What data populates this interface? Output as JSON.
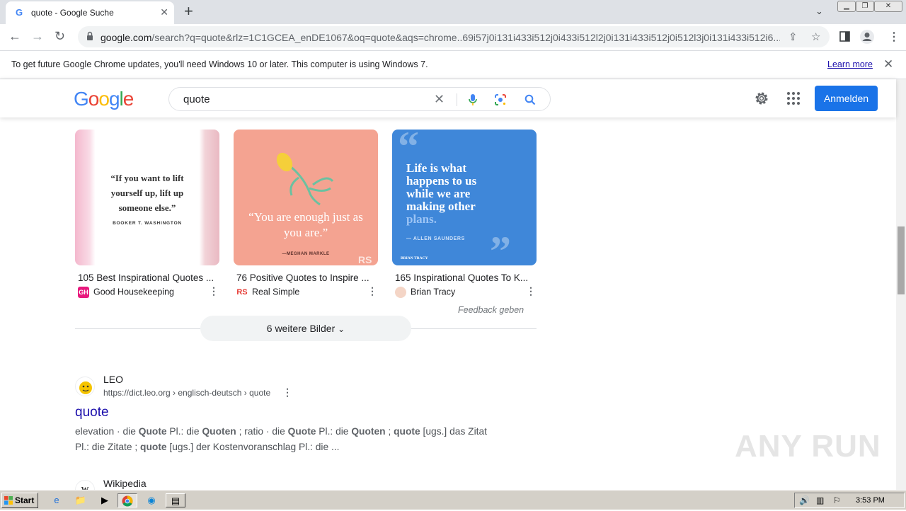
{
  "browser": {
    "tab_title": "quote - Google Suche",
    "url_host": "google.com",
    "url_rest": "/search?q=quote&rlz=1C1GCEA_enDE1067&oq=quote&aqs=chrome..69i57j0i131i433i512j0i433i512l2j0i131i433i512j0i512l3j0i131i433i512i6...",
    "infobar_message": "To get future Google Chrome updates, you'll need Windows 10 or later. This computer is using Windows 7.",
    "infobar_link": "Learn more"
  },
  "google": {
    "logo": "Google",
    "query": "quote",
    "signin_label": "Anmelden"
  },
  "images": [
    {
      "title": "105 Best Inspirational Quotes ...",
      "source": "Good Housekeeping",
      "source_icon": "GH",
      "quote": "“If you want to lift yourself up, lift up someone else.”",
      "author": "BOOKER T. WASHINGTON"
    },
    {
      "title": "76 Positive Quotes to Inspire ...",
      "source": "Real Simple",
      "source_icon": "RS",
      "quote": "“You are enough just as you are.”",
      "author": "—MEGHAN MARKLE"
    },
    {
      "title": "165 Inspirational Quotes To K...",
      "source": "Brian Tracy",
      "quote_main": "Life is what happens to us while we are making other",
      "quote_end": "plans.",
      "author": "— ALLEN SAUNDERS",
      "brand": "BRIAN TRACY"
    }
  ],
  "feedback": "Feedback geben",
  "more_images": "6 weitere Bilder",
  "results": [
    {
      "site": "LEO",
      "url": "https://dict.leo.org › englisch-deutsch › quote",
      "title": "quote"
    },
    {
      "site": "Wikipedia"
    }
  ],
  "snippet": {
    "s1": "elevation · die ",
    "s2": "Quote",
    "s3": " Pl.: die ",
    "s4": "Quoten",
    "s5": " ; ratio · die ",
    "s6": "Quote",
    "s7": " Pl.: die ",
    "s8": "Quoten",
    "s9": " ; ",
    "s10": "quote",
    "s11": " [ugs.] das Zitat Pl.: die Zitate ; ",
    "s12": "quote",
    "s13": " [ugs.] der Kostenvoranschlag Pl.: die ..."
  },
  "watermark": "ANY RUN",
  "taskbar": {
    "start_label": "Start",
    "clock": "3:53 PM"
  }
}
